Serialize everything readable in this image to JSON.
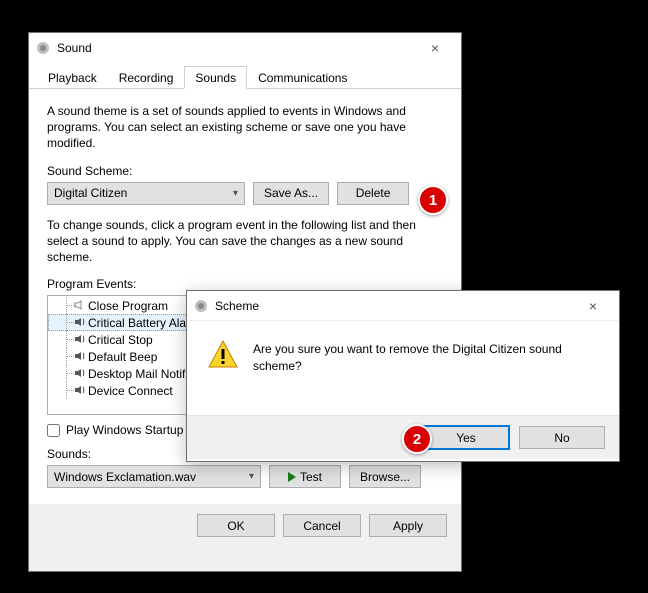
{
  "main": {
    "title": "Sound",
    "tabs": [
      "Playback",
      "Recording",
      "Sounds",
      "Communications"
    ],
    "activeTab": 2,
    "intro": "A sound theme is a set of sounds applied to events in Windows and programs.  You can select an existing scheme or save one you have modified.",
    "scheme_label": "Sound Scheme:",
    "scheme_value": "Digital Citizen",
    "save_as": "Save As...",
    "delete": "Delete",
    "change_hint": "To change sounds, click a program event in the following list and then select a sound to apply.  You can save the changes as a new sound scheme.",
    "events_label": "Program Events:",
    "events": [
      {
        "label": "Close Program",
        "hasSound": false
      },
      {
        "label": "Critical Battery Alarm",
        "hasSound": true,
        "selected": true
      },
      {
        "label": "Critical Stop",
        "hasSound": true
      },
      {
        "label": "Default Beep",
        "hasSound": true
      },
      {
        "label": "Desktop Mail Notification",
        "hasSound": true
      },
      {
        "label": "Device Connect",
        "hasSound": true
      }
    ],
    "startup_check": "Play Windows Startup sound",
    "startup_checked": false,
    "sounds_label": "Sounds:",
    "sounds_value": "Windows Exclamation.wav",
    "test": "Test",
    "browse": "Browse...",
    "ok": "OK",
    "cancel": "Cancel",
    "apply": "Apply"
  },
  "popup": {
    "title": "Scheme",
    "message": "Are you sure you want to remove the Digital Citizen sound scheme?",
    "yes": "Yes",
    "no": "No"
  },
  "callouts": {
    "c1": "1",
    "c2": "2"
  }
}
